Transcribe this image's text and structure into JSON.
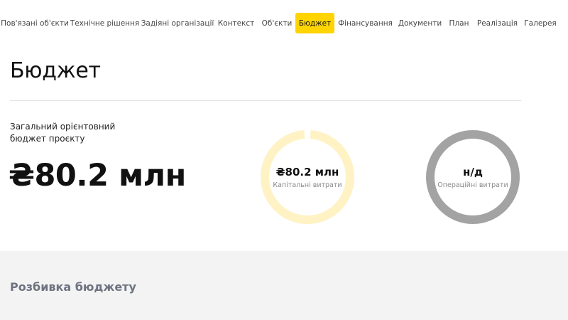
{
  "nav": {
    "items": [
      {
        "label": "Пов'язані об'єкти",
        "active": false
      },
      {
        "label": "Технічне рішення",
        "active": false
      },
      {
        "label": "Задіяні організації",
        "active": false
      },
      {
        "label": "Контекст",
        "active": false
      },
      {
        "label": "Об'єкти",
        "active": false
      },
      {
        "label": "Бюджет",
        "active": true
      },
      {
        "label": "Фінансування",
        "active": false
      },
      {
        "label": "Документи",
        "active": false
      },
      {
        "label": "План",
        "active": false
      },
      {
        "label": "Реалізація",
        "active": false
      },
      {
        "label": "Галерея",
        "active": false
      }
    ],
    "active_color": "#ffd400"
  },
  "page": {
    "title": "Бюджет"
  },
  "budget": {
    "total_label": "Загальний орієнтовний бюджет проєкту",
    "total_value": "₴80.2 млн",
    "capex": {
      "value": "₴80.2 млн",
      "caption": "Капітальні витрати",
      "ring_color": "#fff2c4"
    },
    "opex": {
      "value": "н/д",
      "caption": "Операційні витрати",
      "ring_color": "#a3a3a3"
    }
  },
  "breakdown": {
    "title": "Розбивка бюджету"
  }
}
